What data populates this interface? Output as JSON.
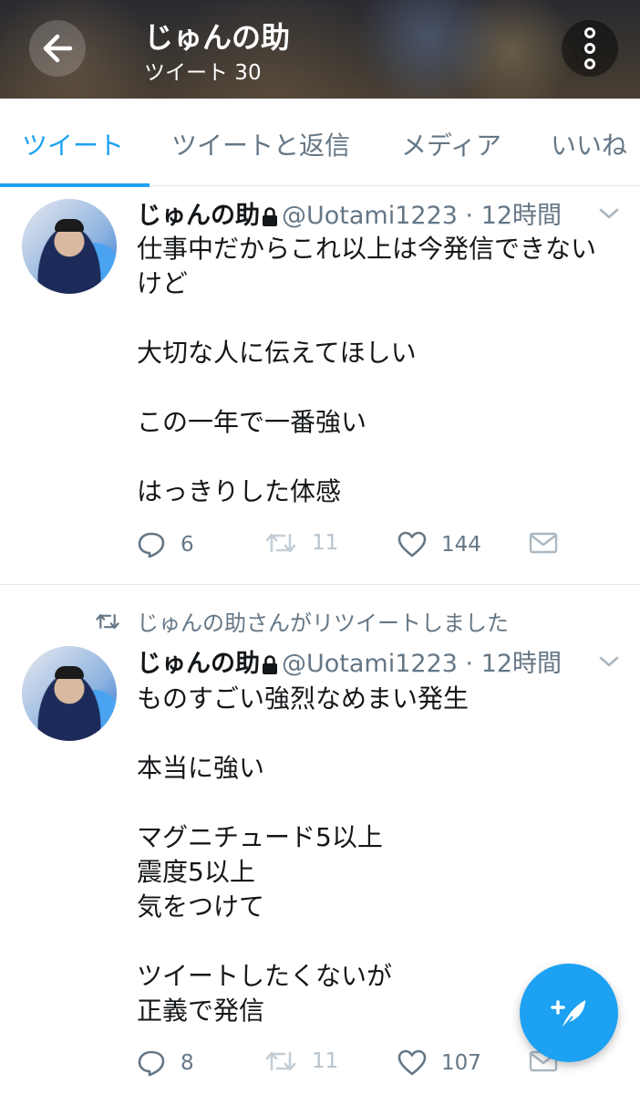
{
  "header": {
    "title": "じゅんの助",
    "subtitle": "ツイート 30",
    "back_icon": "arrow-left-icon",
    "more_icon": "more-vertical-icon"
  },
  "tabs": [
    {
      "label": "ツイート",
      "active": true
    },
    {
      "label": "ツイートと返信",
      "active": false
    },
    {
      "label": "メディア",
      "active": false
    },
    {
      "label": "いいね",
      "active": false
    }
  ],
  "tweets": [
    {
      "name": "じゅんの助",
      "handle": "@Uotami1223",
      "time": "· 12時間",
      "protected": true,
      "body": "仕事中だからこれ以上は今発信できない\nけど\n\n大切な人に伝えてほしい\n\nこの一年で一番強い\n\nはっきりした体感",
      "replies": "6",
      "retweets": "11",
      "likes": "144"
    },
    {
      "retweet_label": "じゅんの助さんがリツイートしました",
      "name": "じゅんの助",
      "handle": "@Uotami1223",
      "time": "· 12時間",
      "protected": true,
      "body": "ものすごい強烈なめまい発生\n\n本当に強い\n\nマグニチュード5以上\n震度5以上\n気をつけて\n\nツイートしたくないが\n正義で発信",
      "replies": "8",
      "retweets": "11",
      "likes": "107"
    }
  ],
  "colors": {
    "accent": "#1da1f2",
    "secondary_text": "#657786",
    "divider": "#e1e8ed"
  },
  "fab": {
    "icon": "compose-tweet-icon"
  }
}
